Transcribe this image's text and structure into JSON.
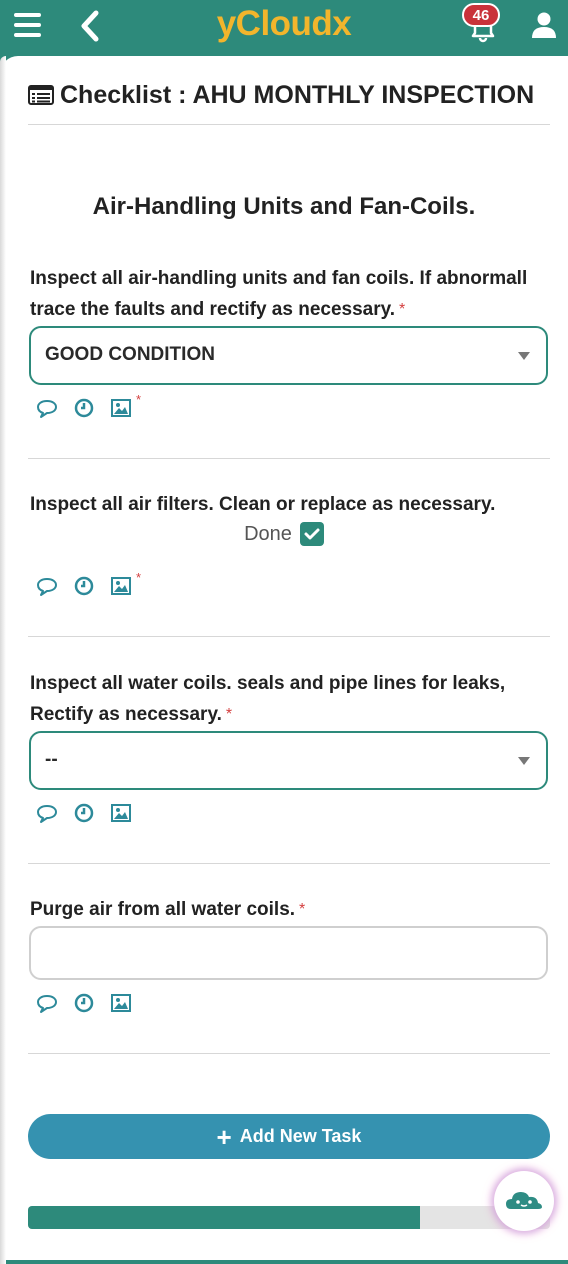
{
  "header": {
    "app_name": "yCloudx",
    "notification_count": "46"
  },
  "page": {
    "checklist_title": "Checklist : AHU MONTHLY INSPECTION",
    "section_title": "Air-Handling Units and Fan-Coils."
  },
  "questions": [
    {
      "label": "Inspect all air-handling units and fan coils. If abnormall trace the faults and rectify as necessary.",
      "required_mark": "*",
      "type": "select",
      "value": "GOOD CONDITION",
      "image_required_mark": "*"
    },
    {
      "label": "Inspect all air filters. Clean or replace as necessary.",
      "type": "checkbox",
      "checkbox_label": "Done",
      "checked": true,
      "image_required_mark": "*"
    },
    {
      "label": "Inspect all water coils. seals and pipe lines for leaks, Rectify as necessary.",
      "required_mark": "*",
      "type": "select",
      "value": "--"
    },
    {
      "label": "Purge air from all water coils.",
      "required_mark": "*",
      "type": "text",
      "value": ""
    }
  ],
  "actions": {
    "add_task_label": "Add New Task"
  },
  "progress": {
    "fraction": 0.75
  },
  "icons": {
    "menu": "hamburger-icon",
    "back": "chevron-left-icon",
    "notifications": "bell-icon",
    "profile": "user-icon",
    "comment": "comment-icon",
    "history": "clock-icon",
    "image": "image-icon",
    "assistant": "cloud-bot-icon"
  },
  "colors": {
    "primary": "#2d8a7b",
    "logo": "#f2b52c",
    "button": "#3592b0",
    "required": "#d43f3f",
    "badge": "#c9323a"
  }
}
